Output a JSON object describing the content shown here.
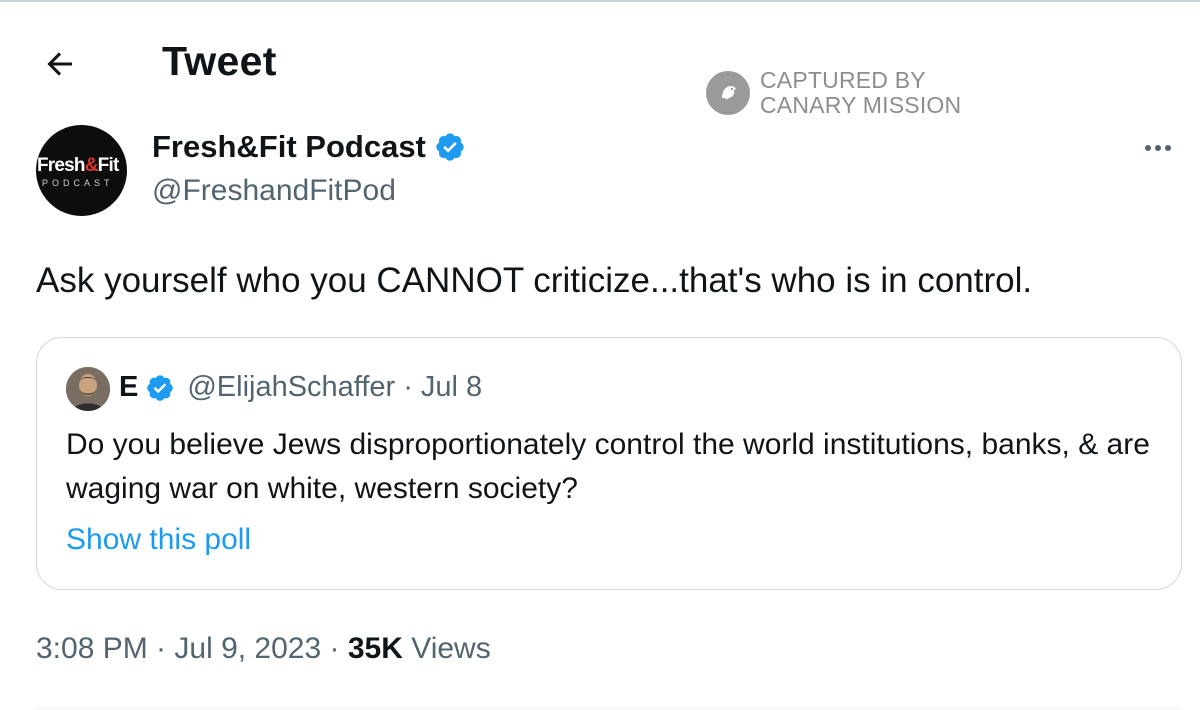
{
  "header": {
    "title": "Tweet",
    "back_icon": "arrow-left-icon"
  },
  "watermark": {
    "line1": "CAPTURED BY",
    "line2": "CANARY MISSION",
    "icon": "canary-bird-icon"
  },
  "tweet": {
    "author": {
      "name": "Fresh&Fit Podcast",
      "handle": "@FreshandFitPod",
      "avatar_text_main": "Fresh",
      "avatar_text_amp": "&",
      "avatar_text_fit": "Fit",
      "avatar_text_sub": "PODCAST",
      "verified": true
    },
    "more_icon": "more-horizontal-icon",
    "text": "Ask yourself who you CANNOT criticize...that's who is in control.",
    "timestamp": "3:08 PM · Jul 9, 2023",
    "separator": " · ",
    "views_count": "35K",
    "views_label": " Views"
  },
  "quoted_tweet": {
    "name": "E",
    "handle": "@ElijahSchaffer",
    "dot": "·",
    "date": "Jul 8",
    "verified": true,
    "text": "Do you believe Jews disproportionately control the world institutions, banks, & are waging war on white, western society?",
    "poll_link": "Show this poll"
  },
  "colors": {
    "text_primary": "#0f1419",
    "text_secondary": "#536471",
    "link": "#1d9bf0",
    "verified": "#1d9bf0",
    "border": "#cfd9de",
    "watermark": "#8d8d8d"
  }
}
